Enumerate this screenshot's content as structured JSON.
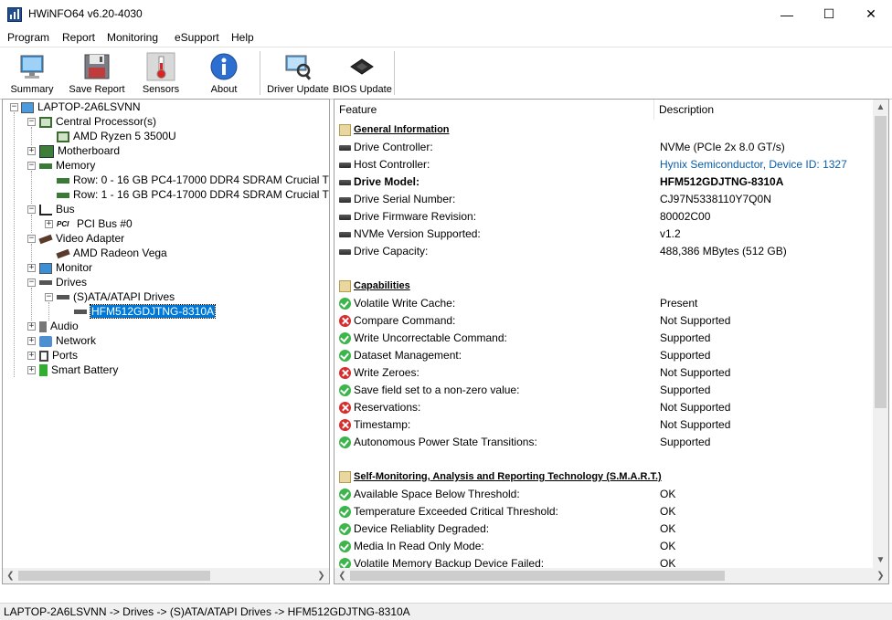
{
  "window": {
    "title": "HWiNFO64 v6.20-4030",
    "controls": {
      "minimize": "—",
      "maximize": "☐",
      "close": "✕"
    }
  },
  "menu": [
    {
      "label": "Program"
    },
    {
      "label": "Report"
    },
    {
      "label": "Monitoring"
    },
    {
      "label": "eSupport"
    },
    {
      "label": "Help"
    }
  ],
  "toolbar": [
    {
      "label": "Summary",
      "icon": "monitor-icon"
    },
    {
      "label": "Save Report",
      "icon": "floppy-disk-icon"
    },
    {
      "label": "Sensors",
      "icon": "thermometer-icon"
    },
    {
      "label": "About",
      "icon": "info-icon"
    },
    {
      "label": "Driver Update",
      "icon": "driver-update-icon"
    },
    {
      "label": "BIOS Update",
      "icon": "chip-icon"
    }
  ],
  "tree": [
    {
      "label": "LAPTOP-2A6LSVNN",
      "icon": "computer-icon"
    },
    {
      "label": "Central Processor(s)",
      "icon": "cpu-icon"
    },
    {
      "label": "AMD Ryzen 5 3500U",
      "icon": "cpu-icon"
    },
    {
      "label": "Motherboard",
      "icon": "motherboard-icon"
    },
    {
      "label": "Memory",
      "icon": "memory-icon"
    },
    {
      "label": "Row: 0 - 16 GB PC4-17000 DDR4 SDRAM Crucial T",
      "icon": "memory-icon"
    },
    {
      "label": "Row: 1 - 16 GB PC4-17000 DDR4 SDRAM Crucial T",
      "icon": "memory-icon"
    },
    {
      "label": "Bus",
      "icon": "bus-icon"
    },
    {
      "label": "PCI Bus #0",
      "icon": "pci-icon"
    },
    {
      "label": "Video Adapter",
      "icon": "gpu-icon"
    },
    {
      "label": "AMD Radeon Vega",
      "icon": "gpu-icon"
    },
    {
      "label": "Monitor",
      "icon": "monitor-icon"
    },
    {
      "label": "Drives",
      "icon": "drive-icon"
    },
    {
      "label": "(S)ATA/ATAPI Drives",
      "icon": "drive-icon"
    },
    {
      "label": "HFM512GDJTNG-8310A",
      "icon": "drive-icon"
    },
    {
      "label": "Audio",
      "icon": "speaker-icon"
    },
    {
      "label": "Network",
      "icon": "network-icon"
    },
    {
      "label": "Ports",
      "icon": "ports-icon"
    },
    {
      "label": "Smart Battery",
      "icon": "battery-icon"
    }
  ],
  "details": {
    "columns": {
      "feature": "Feature",
      "description": "Description"
    },
    "rows": [
      {
        "type": "section",
        "feature": "General Information",
        "description": ""
      },
      {
        "type": "drive",
        "feature": "Drive Controller:",
        "description": "NVMe (PCIe 2x 8.0 GT/s)"
      },
      {
        "type": "drive",
        "feature": "Host Controller:",
        "description": "Hynix Semiconductor, Device ID: 1327",
        "link": true
      },
      {
        "type": "drive",
        "feature": "Drive Model:",
        "description": "HFM512GDJTNG-8310A",
        "bold": true
      },
      {
        "type": "drive",
        "feature": "Drive Serial Number:",
        "description": "CJ97N5338110Y7Q0N"
      },
      {
        "type": "drive",
        "feature": "Drive Firmware Revision:",
        "description": "80002C00"
      },
      {
        "type": "drive",
        "feature": "NVMe Version Supported:",
        "description": "v1.2"
      },
      {
        "type": "drive",
        "feature": "Drive Capacity:",
        "description": "488,386 MBytes (512 GB)"
      },
      {
        "type": "blank",
        "feature": "",
        "description": ""
      },
      {
        "type": "section",
        "feature": "Capabilities",
        "description": ""
      },
      {
        "type": "ok",
        "feature": "Volatile Write Cache:",
        "description": "Present"
      },
      {
        "type": "no",
        "feature": "Compare Command:",
        "description": "Not Supported"
      },
      {
        "type": "ok",
        "feature": "Write Uncorrectable Command:",
        "description": "Supported"
      },
      {
        "type": "ok",
        "feature": "Dataset Management:",
        "description": "Supported"
      },
      {
        "type": "no",
        "feature": "Write Zeroes:",
        "description": "Not Supported"
      },
      {
        "type": "ok",
        "feature": "Save field set to a non-zero value:",
        "description": "Supported"
      },
      {
        "type": "no",
        "feature": "Reservations:",
        "description": "Not Supported"
      },
      {
        "type": "no",
        "feature": "Timestamp:",
        "description": "Not Supported"
      },
      {
        "type": "ok",
        "feature": "Autonomous Power State Transitions:",
        "description": "Supported"
      },
      {
        "type": "blank",
        "feature": "",
        "description": ""
      },
      {
        "type": "section",
        "feature": "Self-Monitoring, Analysis and Reporting Technology (S.M.A.R.T.)",
        "description": ""
      },
      {
        "type": "ok",
        "feature": "Available Space Below Threshold:",
        "description": "OK"
      },
      {
        "type": "ok",
        "feature": "Temperature Exceeded Critical Threshold:",
        "description": "OK"
      },
      {
        "type": "ok",
        "feature": "Device Reliablity Degraded:",
        "description": "OK"
      },
      {
        "type": "ok",
        "feature": "Media In Read Only Mode:",
        "description": "OK"
      },
      {
        "type": "ok",
        "feature": "Volatile Memory Backup Device Failed:",
        "description": "OK"
      }
    ]
  },
  "statusbar": {
    "path": "LAPTOP-2A6LSVNN -> Drives -> (S)ATA/ATAPI Drives -> HFM512GDJTNG-8310A"
  },
  "colors": {
    "selection": "#0078d7",
    "ok": "#3cb54a",
    "error": "#d92c2c",
    "link": "#0a5ea8"
  }
}
